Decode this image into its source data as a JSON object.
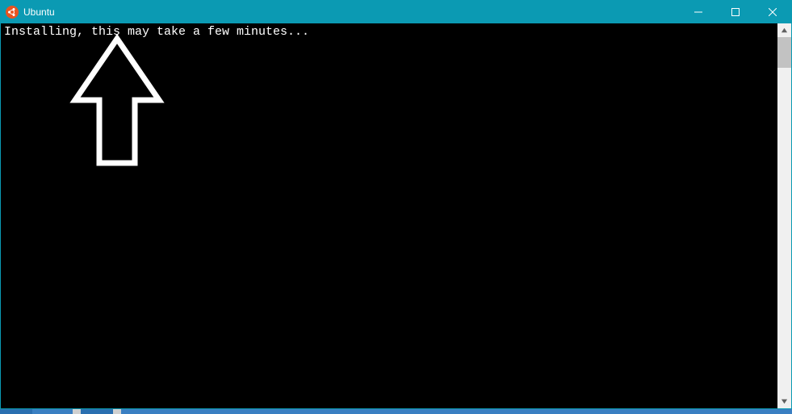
{
  "window": {
    "title": "Ubuntu",
    "app_icon_name": "ubuntu-icon"
  },
  "terminal": {
    "line1": "Installing, this may take a few minutes..."
  }
}
